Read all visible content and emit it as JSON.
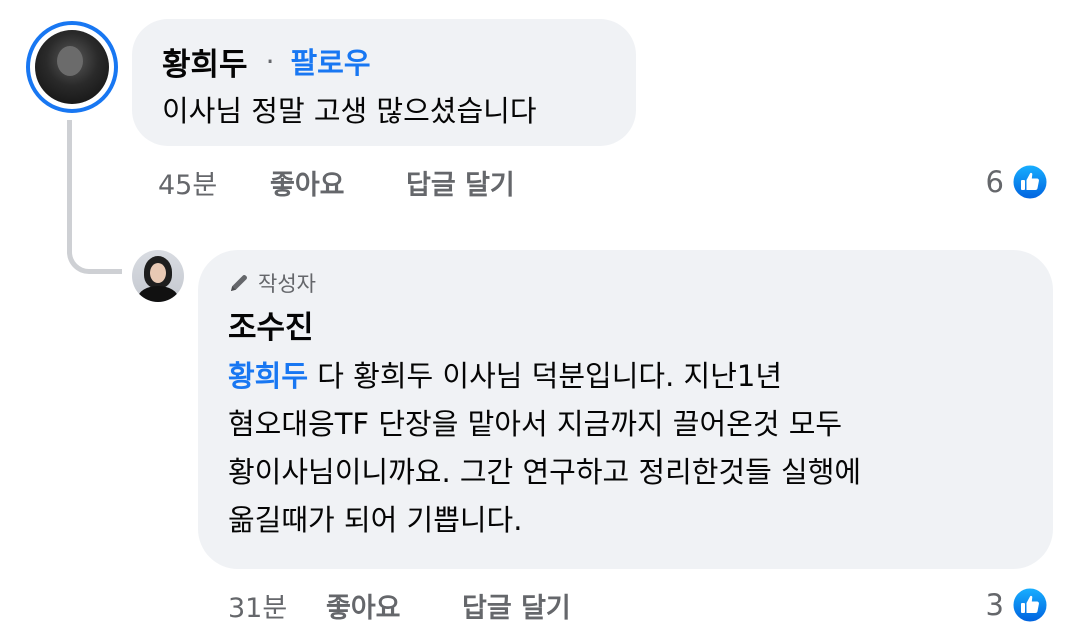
{
  "comments": [
    {
      "author": "황희두",
      "separator": "·",
      "follow_label": "팔로우",
      "text": "이사님 정말 고생 많으셨습니다",
      "time": "45분",
      "like_label": "좋아요",
      "reply_label": "답글 달기",
      "reaction_count": "6",
      "reaction_icon": "like-icon"
    }
  ],
  "reply": {
    "badge": "작성자",
    "badge_icon": "pencil-icon",
    "author": "조수진",
    "mention": "황희두",
    "lines": [
      " 다 황희두 이사님 덕분입니다. 지난1년",
      "혐오대응TF 단장을 맡아서 지금까지 끌어온것 모두",
      "황이사님이니까요. 그간 연구하고 정리한것들 실행에",
      "옮길때가 되어 기쁩니다."
    ],
    "time": "31분",
    "like_label": "좋아요",
    "reply_label": "답글 달기",
    "reaction_count": "3",
    "reaction_icon": "like-icon"
  },
  "colors": {
    "accent": "#1877f2",
    "bubble": "#f0f2f5",
    "muted": "#65676b",
    "thread_line": "#ced0d4"
  }
}
